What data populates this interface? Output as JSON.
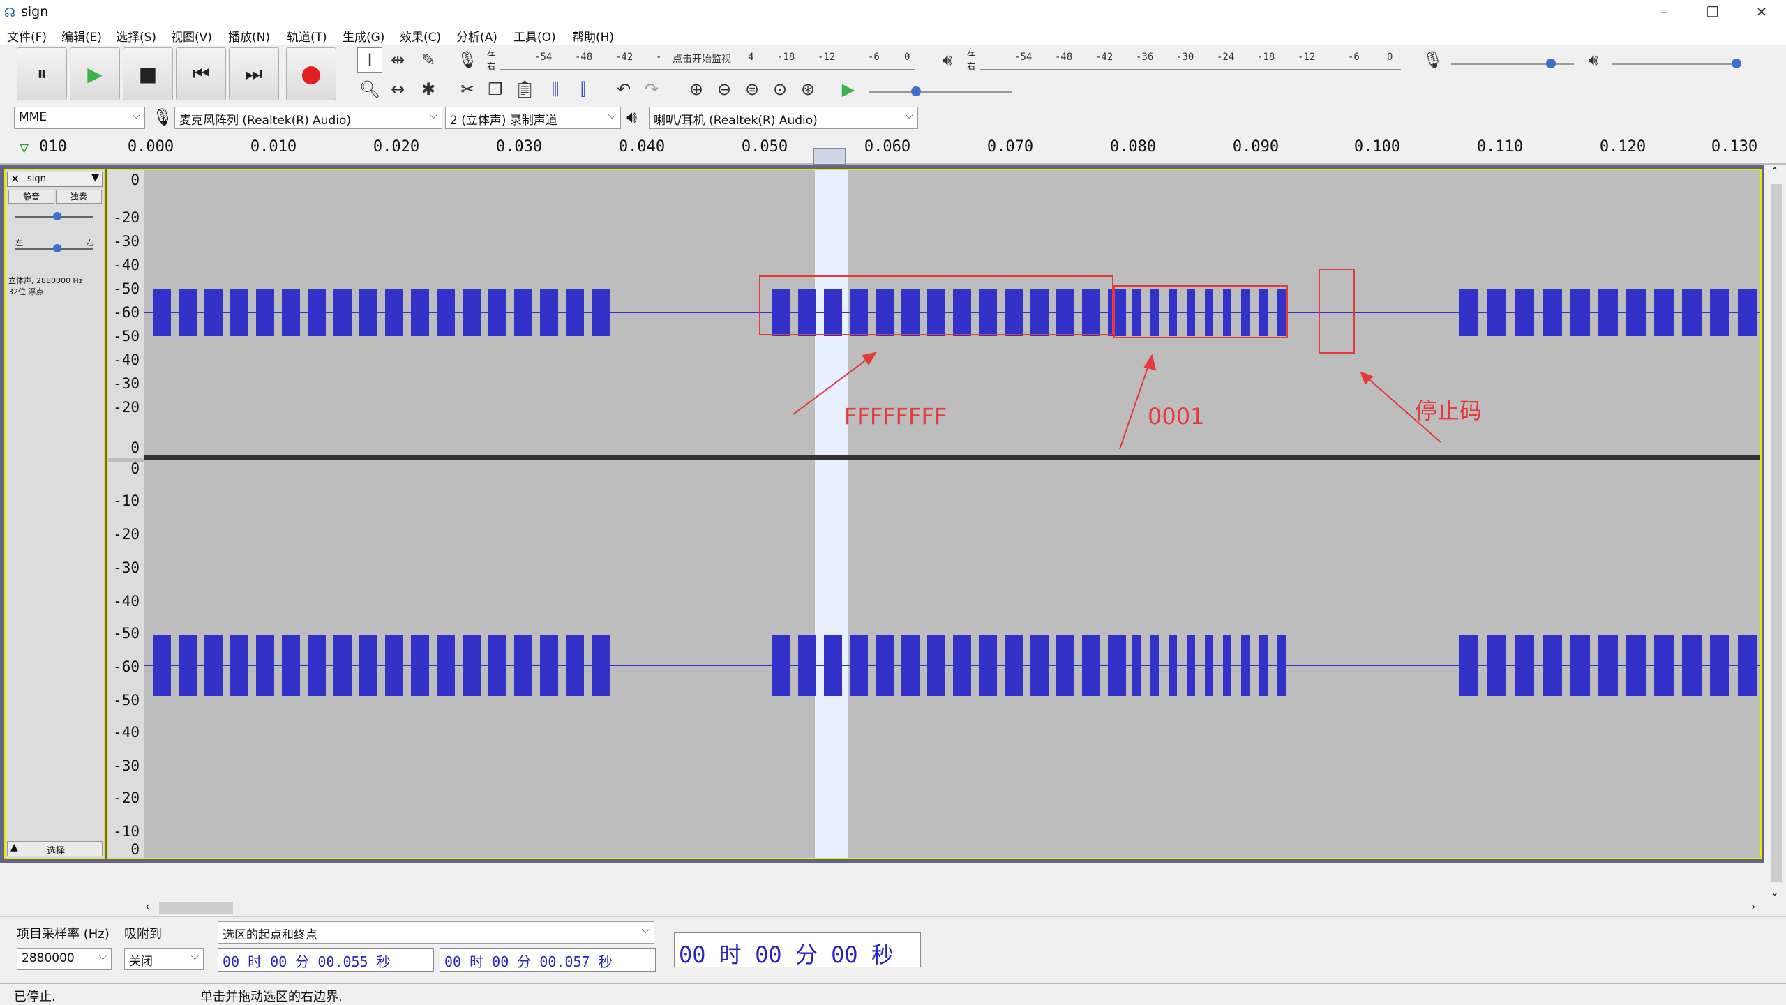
{
  "window": {
    "title": "sign",
    "minimize": "–",
    "maximize": "❐",
    "close": "✕"
  },
  "menu": [
    "文件(F)",
    "编辑(E)",
    "选择(S)",
    "视图(V)",
    "播放(N)",
    "轨道(T)",
    "生成(G)",
    "效果(C)",
    "分析(A)",
    "工具(O)",
    "帮助(H)"
  ],
  "transport": {
    "pause": "⏸",
    "play": "▶",
    "stop": "■",
    "skip_start": "⏮",
    "skip_end": "⏭",
    "record": "●"
  },
  "record_meter": {
    "channel_l": "左",
    "channel_r": "右",
    "ticks": [
      "-54",
      "-48",
      "-42",
      "-",
      "点击开始监视",
      "4",
      "-18",
      "-12",
      "-6",
      "0"
    ]
  },
  "playback_meter": {
    "channel_l": "左",
    "channel_r": "右",
    "ticks": [
      "-54",
      "-48",
      "-42",
      "-36",
      "-30",
      "-24",
      "-18",
      "-12",
      "-6",
      "0"
    ]
  },
  "devices": {
    "host": "MME",
    "input": "麦克风阵列 (Realtek(R) Audio)",
    "channels": "2 (立体声) 录制声道",
    "output": "喇叭/耳机 (Realtek(R) Audio)"
  },
  "ruler": {
    "labels": [
      "010",
      "0.000",
      "0.010",
      "0.020",
      "0.030",
      "0.040",
      "0.050",
      "0.060",
      "0.070",
      "0.080",
      "0.090",
      "0.100",
      "0.110",
      "0.120",
      "0.130"
    ]
  },
  "track": {
    "name": "sign",
    "mute": "静音",
    "solo": "独奏",
    "pan_left": "左",
    "pan_right": "右",
    "info_line1": "立体声, 2880000 Hz",
    "info_line2": "32位 浮点",
    "select": "选择",
    "vruler_top": [
      "0",
      "-20",
      "-30",
      "-40",
      "-50",
      "-60",
      "-50",
      "-40",
      "-30",
      "-20",
      "0"
    ],
    "vruler_bottom": [
      "0",
      "-10",
      "-20",
      "-30",
      "-40",
      "-50",
      "-60",
      "-50",
      "-40",
      "-30",
      "-20",
      "-10",
      "0"
    ]
  },
  "annotations": {
    "label1": "FFFFFFFF",
    "label2": "0001",
    "label3": "停止码"
  },
  "selection_toolbar": {
    "rate_label": "项目采样率 (Hz)",
    "rate_value": "2880000",
    "snap_label": "吸附到",
    "snap_value": "关闭",
    "mode": "选区的起点和终点",
    "start": "00 时 00 分 00.055 秒",
    "end": "00 时 00 分 00.057 秒",
    "audio_position": "00 时 00 分 00 秒"
  },
  "status": {
    "left": "已停止.",
    "hint": "单击并拖动选区的右边界."
  },
  "colors": {
    "waveform": "#3232c8",
    "selection": "#e8f0ff",
    "track_bg": "#bdbdbd",
    "annotation": "#e43a3a",
    "frame": "#e8e800"
  }
}
